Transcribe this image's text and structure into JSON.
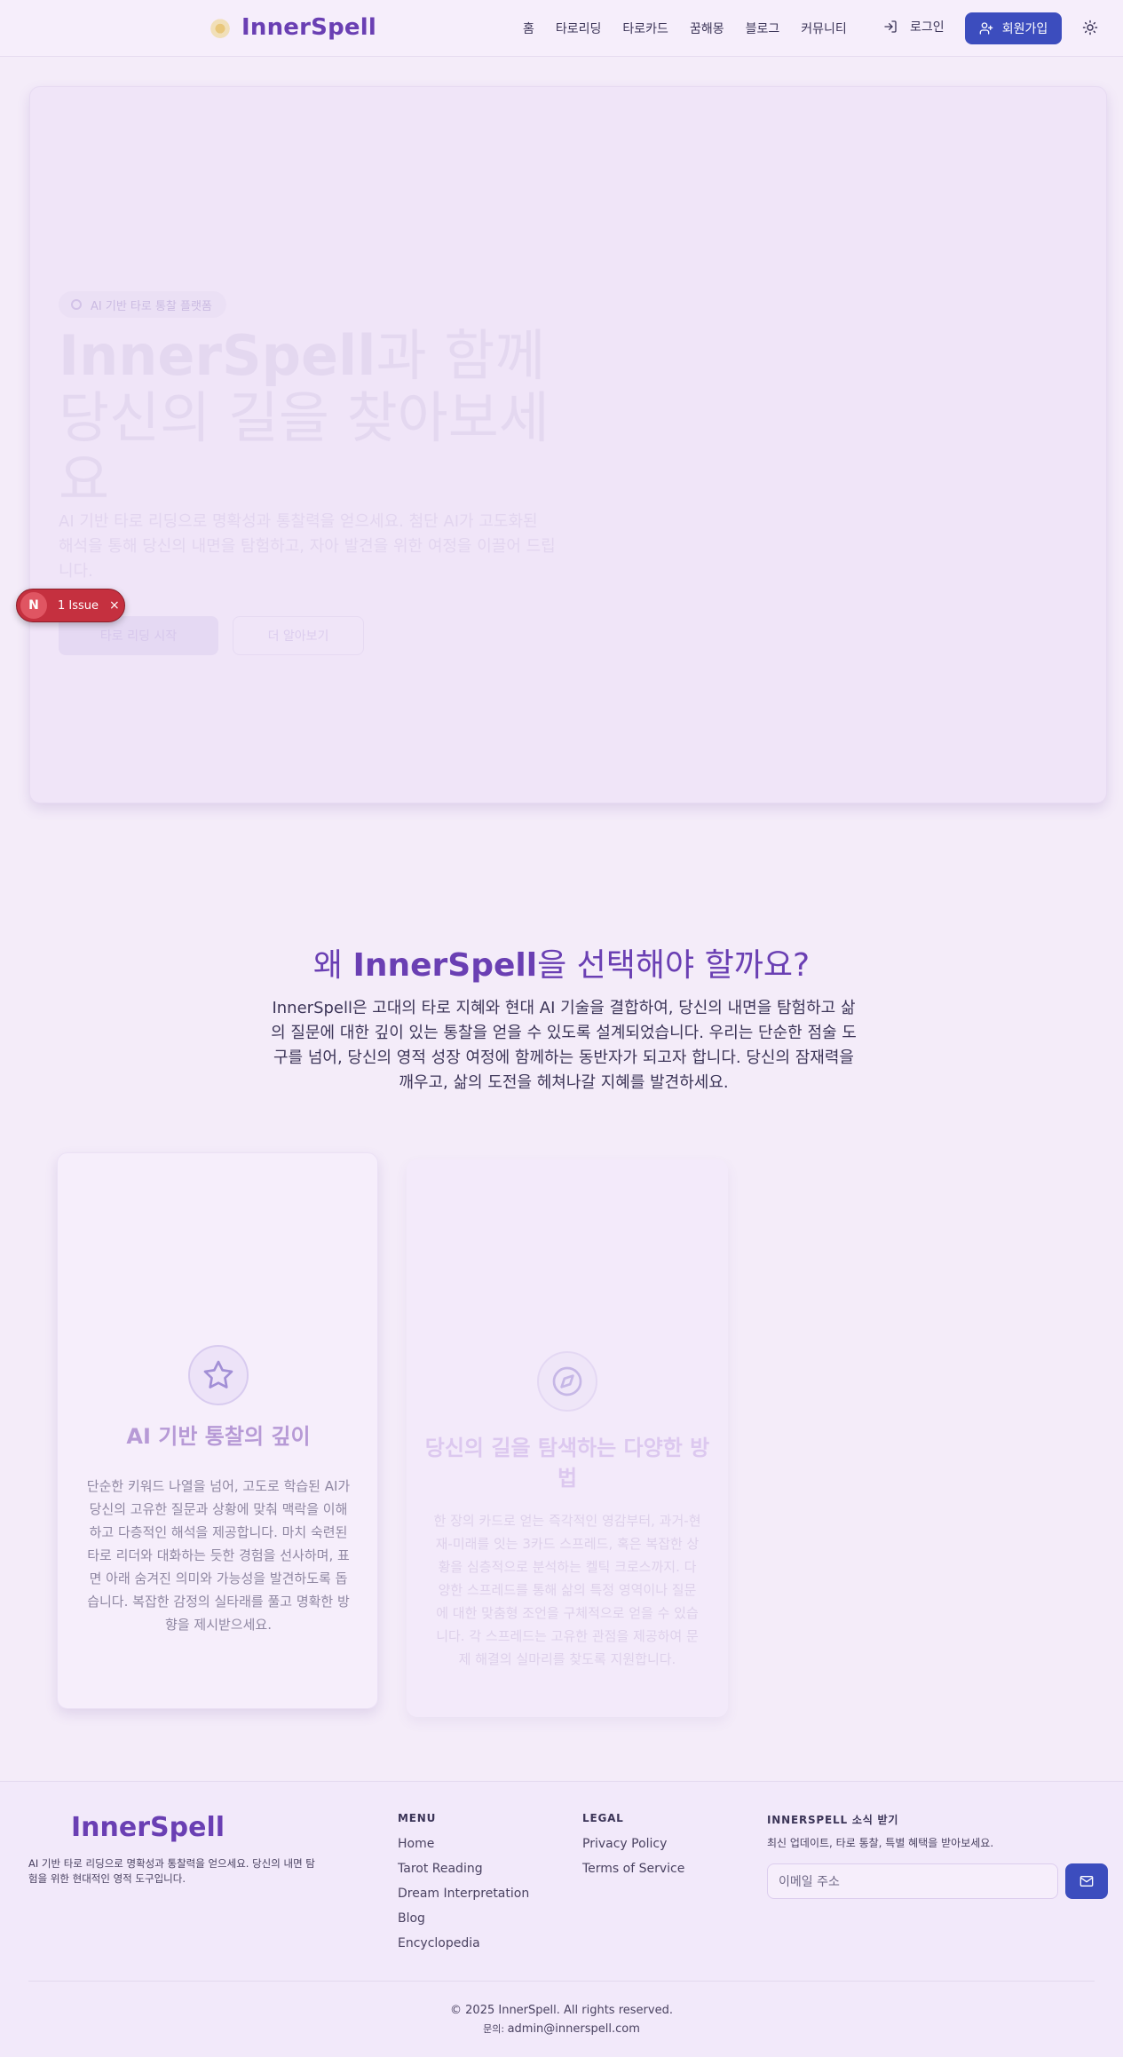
{
  "header": {
    "brand": "InnerSpell",
    "nav": [
      "홈",
      "타로리딩",
      "타로카드",
      "꿈해몽",
      "블로그",
      "커뮤니티"
    ],
    "login_label": "로그인",
    "signup_label": "회원가입"
  },
  "hero": {
    "badge": "AI 기반 타로 통찰 플랫폼",
    "title_brand": "InnerSpell",
    "title_rest": "과 함께 당신의 길을 찾아보세요",
    "description": "AI 기반 타로 리딩으로 명확성과 통찰력을 얻으세요. 첨단 AI가 고도화된 해석을 통해 당신의 내면을 탐험하고, 자아 발견을 위한 여정을 이끌어 드립니다.",
    "primary_button": "타로 리딩 시작",
    "secondary_button": "더 알아보기"
  },
  "issue_indicator": {
    "badge": "N",
    "label": "1 Issue",
    "close": "×"
  },
  "why": {
    "title_pre": "왜 ",
    "title_brand": "InnerSpell",
    "title_post": "을 선택해야 할까요?",
    "description": "InnerSpell은 고대의 타로 지혜와 현대 AI 기술을 결합하여, 당신의 내면을 탐험하고 삶의 질문에 대한 깊이 있는 통찰을 얻을 수 있도록 설계되었습니다. 우리는 단순한 점술 도구를 넘어, 당신의 영적 성장 여정에 함께하는 동반자가 되고자 합니다. 당신의 잠재력을 깨우고, 삶의 도전을 헤쳐나갈 지혜를 발견하세요.",
    "cards": [
      {
        "icon": "star-icon",
        "title": "AI 기반 통찰의 깊이",
        "description": "단순한 키워드 나열을 넘어, 고도로 학습된 AI가 당신의 고유한 질문과 상황에 맞춰 맥락을 이해하고 다층적인 해석을 제공합니다. 마치 숙련된 타로 리더와 대화하는 듯한 경험을 선사하며, 표면 아래 숨겨진 의미와 가능성을 발견하도록 돕습니다. 복잡한 감정의 실타래를 풀고 명확한 방향을 제시받으세요."
      },
      {
        "icon": "compass-icon",
        "title": "당신의 길을 탐색하는 다양한 방법",
        "description": "한 장의 카드로 얻는 즉각적인 영감부터, 과거-현재-미래를 잇는 3카드 스프레드, 혹은 복잡한 상황을 심층적으로 분석하는 켈틱 크로스까지. 다양한 스프레드를 통해 삶의 특정 영역이나 질문에 대한 맞춤형 조언을 구체적으로 얻을 수 있습니다. 각 스프레드는 고유한 관점을 제공하여 문제 해결의 실마리를 찾도록 지원합니다."
      }
    ]
  },
  "footer": {
    "brand": "InnerSpell",
    "tagline": "AI 기반 타로 리딩으로 명확성과 통찰력을 얻으세요. 당신의 내면 탐험을 위한 현대적인 영적 도구입니다.",
    "menu_title": "MENU",
    "menu": [
      "Home",
      "Tarot Reading",
      "Dream Interpretation",
      "Blog",
      "Encyclopedia"
    ],
    "legal_title": "LEGAL",
    "legal": [
      "Privacy Policy",
      "Terms of Service"
    ],
    "newsletter_title": "INNERSPELL 소식 받기",
    "newsletter_desc": "최신 업데이트, 타로 통찰, 특별 혜택을 받아보세요.",
    "email_placeholder": "이메일 주소",
    "copyright": "© 2025 InnerSpell. All rights reserved.",
    "contact_label": "문의: ",
    "contact_email": "admin@innerspell.com"
  },
  "colors": {
    "brand": "#6a3fb3",
    "accent": "#3c4dbe",
    "background": "#f4ecf9",
    "issue": "#c5303f"
  }
}
